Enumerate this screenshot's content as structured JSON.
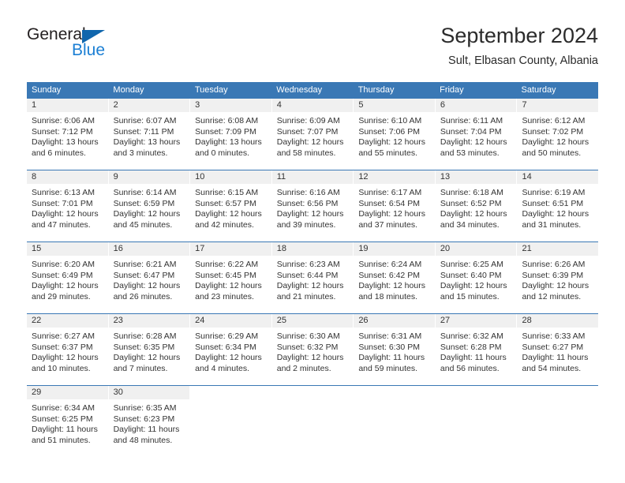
{
  "brand": {
    "name_top": "General",
    "name_bottom": "Blue",
    "accent_color": "#1b7fd4",
    "triangle_color": "#1066ad"
  },
  "header": {
    "title": "September 2024",
    "subtitle": "Sult, Elbasan County, Albania"
  },
  "theme": {
    "header_bg": "#3a78b5",
    "header_text": "#ffffff",
    "daynum_band_bg": "#f0f0f0",
    "cell_text": "#333333"
  },
  "weekdays": [
    "Sunday",
    "Monday",
    "Tuesday",
    "Wednesday",
    "Thursday",
    "Friday",
    "Saturday"
  ],
  "weeks": [
    [
      {
        "day": "1",
        "lines": [
          "Sunrise: 6:06 AM",
          "Sunset: 7:12 PM",
          "Daylight: 13 hours",
          "and 6 minutes."
        ]
      },
      {
        "day": "2",
        "lines": [
          "Sunrise: 6:07 AM",
          "Sunset: 7:11 PM",
          "Daylight: 13 hours",
          "and 3 minutes."
        ]
      },
      {
        "day": "3",
        "lines": [
          "Sunrise: 6:08 AM",
          "Sunset: 7:09 PM",
          "Daylight: 13 hours",
          "and 0 minutes."
        ]
      },
      {
        "day": "4",
        "lines": [
          "Sunrise: 6:09 AM",
          "Sunset: 7:07 PM",
          "Daylight: 12 hours",
          "and 58 minutes."
        ]
      },
      {
        "day": "5",
        "lines": [
          "Sunrise: 6:10 AM",
          "Sunset: 7:06 PM",
          "Daylight: 12 hours",
          "and 55 minutes."
        ]
      },
      {
        "day": "6",
        "lines": [
          "Sunrise: 6:11 AM",
          "Sunset: 7:04 PM",
          "Daylight: 12 hours",
          "and 53 minutes."
        ]
      },
      {
        "day": "7",
        "lines": [
          "Sunrise: 6:12 AM",
          "Sunset: 7:02 PM",
          "Daylight: 12 hours",
          "and 50 minutes."
        ]
      }
    ],
    [
      {
        "day": "8",
        "lines": [
          "Sunrise: 6:13 AM",
          "Sunset: 7:01 PM",
          "Daylight: 12 hours",
          "and 47 minutes."
        ]
      },
      {
        "day": "9",
        "lines": [
          "Sunrise: 6:14 AM",
          "Sunset: 6:59 PM",
          "Daylight: 12 hours",
          "and 45 minutes."
        ]
      },
      {
        "day": "10",
        "lines": [
          "Sunrise: 6:15 AM",
          "Sunset: 6:57 PM",
          "Daylight: 12 hours",
          "and 42 minutes."
        ]
      },
      {
        "day": "11",
        "lines": [
          "Sunrise: 6:16 AM",
          "Sunset: 6:56 PM",
          "Daylight: 12 hours",
          "and 39 minutes."
        ]
      },
      {
        "day": "12",
        "lines": [
          "Sunrise: 6:17 AM",
          "Sunset: 6:54 PM",
          "Daylight: 12 hours",
          "and 37 minutes."
        ]
      },
      {
        "day": "13",
        "lines": [
          "Sunrise: 6:18 AM",
          "Sunset: 6:52 PM",
          "Daylight: 12 hours",
          "and 34 minutes."
        ]
      },
      {
        "day": "14",
        "lines": [
          "Sunrise: 6:19 AM",
          "Sunset: 6:51 PM",
          "Daylight: 12 hours",
          "and 31 minutes."
        ]
      }
    ],
    [
      {
        "day": "15",
        "lines": [
          "Sunrise: 6:20 AM",
          "Sunset: 6:49 PM",
          "Daylight: 12 hours",
          "and 29 minutes."
        ]
      },
      {
        "day": "16",
        "lines": [
          "Sunrise: 6:21 AM",
          "Sunset: 6:47 PM",
          "Daylight: 12 hours",
          "and 26 minutes."
        ]
      },
      {
        "day": "17",
        "lines": [
          "Sunrise: 6:22 AM",
          "Sunset: 6:45 PM",
          "Daylight: 12 hours",
          "and 23 minutes."
        ]
      },
      {
        "day": "18",
        "lines": [
          "Sunrise: 6:23 AM",
          "Sunset: 6:44 PM",
          "Daylight: 12 hours",
          "and 21 minutes."
        ]
      },
      {
        "day": "19",
        "lines": [
          "Sunrise: 6:24 AM",
          "Sunset: 6:42 PM",
          "Daylight: 12 hours",
          "and 18 minutes."
        ]
      },
      {
        "day": "20",
        "lines": [
          "Sunrise: 6:25 AM",
          "Sunset: 6:40 PM",
          "Daylight: 12 hours",
          "and 15 minutes."
        ]
      },
      {
        "day": "21",
        "lines": [
          "Sunrise: 6:26 AM",
          "Sunset: 6:39 PM",
          "Daylight: 12 hours",
          "and 12 minutes."
        ]
      }
    ],
    [
      {
        "day": "22",
        "lines": [
          "Sunrise: 6:27 AM",
          "Sunset: 6:37 PM",
          "Daylight: 12 hours",
          "and 10 minutes."
        ]
      },
      {
        "day": "23",
        "lines": [
          "Sunrise: 6:28 AM",
          "Sunset: 6:35 PM",
          "Daylight: 12 hours",
          "and 7 minutes."
        ]
      },
      {
        "day": "24",
        "lines": [
          "Sunrise: 6:29 AM",
          "Sunset: 6:34 PM",
          "Daylight: 12 hours",
          "and 4 minutes."
        ]
      },
      {
        "day": "25",
        "lines": [
          "Sunrise: 6:30 AM",
          "Sunset: 6:32 PM",
          "Daylight: 12 hours",
          "and 2 minutes."
        ]
      },
      {
        "day": "26",
        "lines": [
          "Sunrise: 6:31 AM",
          "Sunset: 6:30 PM",
          "Daylight: 11 hours",
          "and 59 minutes."
        ]
      },
      {
        "day": "27",
        "lines": [
          "Sunrise: 6:32 AM",
          "Sunset: 6:28 PM",
          "Daylight: 11 hours",
          "and 56 minutes."
        ]
      },
      {
        "day": "28",
        "lines": [
          "Sunrise: 6:33 AM",
          "Sunset: 6:27 PM",
          "Daylight: 11 hours",
          "and 54 minutes."
        ]
      }
    ],
    [
      {
        "day": "29",
        "lines": [
          "Sunrise: 6:34 AM",
          "Sunset: 6:25 PM",
          "Daylight: 11 hours",
          "and 51 minutes."
        ]
      },
      {
        "day": "30",
        "lines": [
          "Sunrise: 6:35 AM",
          "Sunset: 6:23 PM",
          "Daylight: 11 hours",
          "and 48 minutes."
        ]
      },
      {
        "day": "",
        "lines": []
      },
      {
        "day": "",
        "lines": []
      },
      {
        "day": "",
        "lines": []
      },
      {
        "day": "",
        "lines": []
      },
      {
        "day": "",
        "lines": []
      }
    ]
  ]
}
